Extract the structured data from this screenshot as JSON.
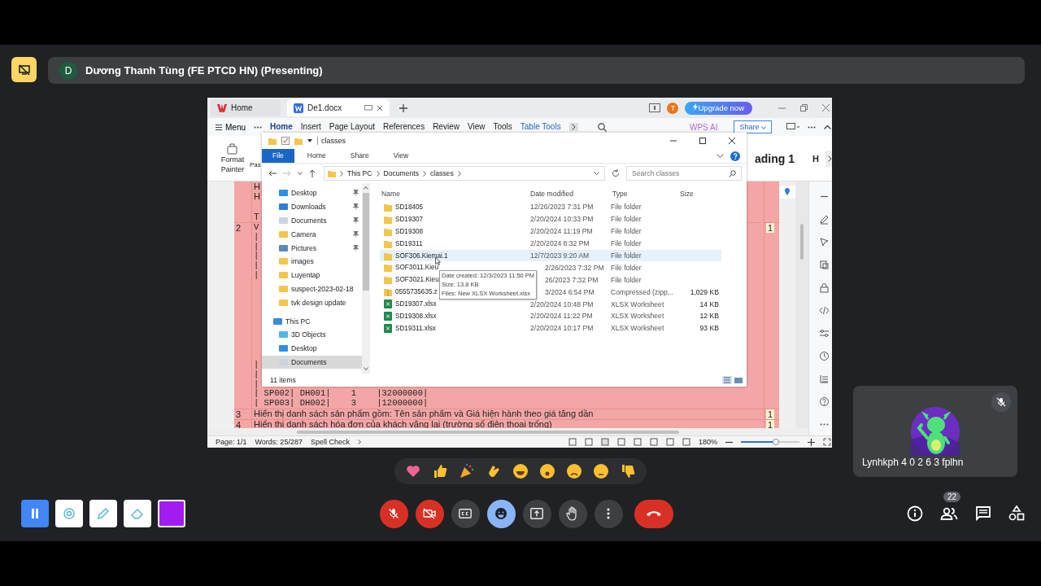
{
  "meeting": {
    "presenter_initial": "D",
    "presenter_title": "Dương Thanh Tùng (FE PTCD HN) (Presenting)"
  },
  "wps": {
    "tabs": [
      {
        "label": "Home",
        "selected": false
      },
      {
        "label": "De1.docx",
        "selected": true
      }
    ],
    "account_initial": "T",
    "upgrade_button": "Upgrade now",
    "menu_button": "Menu",
    "menu_tabs": [
      {
        "label": "Home",
        "selected": true,
        "kind": "normal"
      },
      {
        "label": "Insert",
        "selected": false,
        "kind": "normal"
      },
      {
        "label": "Page Layout",
        "selected": false,
        "kind": "normal"
      },
      {
        "label": "References",
        "selected": false,
        "kind": "normal"
      },
      {
        "label": "Review",
        "selected": false,
        "kind": "normal"
      },
      {
        "label": "View",
        "selected": false,
        "kind": "normal"
      },
      {
        "label": "Tools",
        "selected": false,
        "kind": "normal"
      },
      {
        "label": "Table Tools",
        "selected": false,
        "kind": "contextual"
      }
    ],
    "ai_button": "WPS AI",
    "share_button": "Share",
    "ribbon": {
      "format_painter": "Format Painter",
      "paste": "Pas",
      "style_heading": "ading 1",
      "style_next": "H"
    },
    "rows": [
      {
        "kind": "text",
        "blocks": [
          [
            "H",
            "H"
          ],
          [
            "T"
          ]
        ]
      },
      {
        "kind": "code",
        "number": "2",
        "count": "1",
        "blocks": [
          [
            "V",
            "|",
            "|",
            "|",
            "|",
            "|"
          ],
          [
            "|",
            "|",
            "|",
            "| SP002| DH001|    1    |32000000|",
            "| SP003| DH002|    3    |12000000|"
          ]
        ]
      },
      {
        "kind": "text",
        "number": "3",
        "count": "1",
        "blocks": [
          [
            "Hiển thị danh sách sản phẩm gồm: Tên sản phẩm và Giá hiện hành theo giá tăng dần"
          ]
        ]
      },
      {
        "kind": "text",
        "number": "4",
        "count": "1",
        "blocks": [
          [
            "Hiển thị danh sách hóa đơn của khách vãng lai (trường số điện thoại trống)"
          ]
        ]
      }
    ],
    "status_bar": {
      "page": "Page: 1/1",
      "words": "Words: 25/287",
      "spell_check": "Spell Check",
      "zoom": "180%",
      "level": 0.58
    }
  },
  "explorer": {
    "title": "classes",
    "ribbon_tabs": [
      {
        "label": "File",
        "kind": "file"
      },
      {
        "label": "Home",
        "kind": "tab"
      },
      {
        "label": "Share",
        "kind": "tab"
      },
      {
        "label": "View",
        "kind": "tab"
      }
    ],
    "path": [
      "This PC",
      "Documents",
      "classes"
    ],
    "search": {
      "placeholder": "Search classes"
    },
    "nav": [
      {
        "label": "Desktop",
        "kind": "desktop",
        "pinned": true,
        "selected": false
      },
      {
        "label": "Downloads",
        "kind": "downloads",
        "pinned": true,
        "selected": false
      },
      {
        "label": "Documents",
        "kind": "documents",
        "pinned": true,
        "selected": false
      },
      {
        "label": "Camera",
        "kind": "folder",
        "pinned": true,
        "selected": false
      },
      {
        "label": "Pictures",
        "kind": "pictures",
        "pinned": true,
        "selected": false
      },
      {
        "label": "images",
        "kind": "folder",
        "pinned": false,
        "selected": false
      },
      {
        "label": "Luyentap",
        "kind": "folder",
        "pinned": false,
        "selected": false
      },
      {
        "label": "suspect-2023-02-18",
        "kind": "folder",
        "pinned": false,
        "selected": false
      },
      {
        "label": "tvk design update",
        "kind": "folder",
        "pinned": false,
        "selected": false
      },
      {
        "label": "This PC",
        "kind": "pc",
        "pinned": false,
        "selected": false,
        "children": [
          {
            "label": "3D Objects",
            "kind": "objects",
            "selected": false
          },
          {
            "label": "Desktop",
            "kind": "desktop",
            "selected": false
          },
          {
            "label": "Documents",
            "kind": "documents",
            "selected": true
          }
        ]
      }
    ],
    "columns": [
      "Name",
      "Date modified",
      "Type",
      "Size"
    ],
    "files": [
      {
        "name": "SD18405",
        "date": "12/26/2023 7:31 PM",
        "type": "File folder",
        "kind": "folder",
        "selected": false
      },
      {
        "name": "SD19307",
        "date": "2/20/2024 10:33 PM",
        "type": "File folder",
        "kind": "folder",
        "selected": false
      },
      {
        "name": "SD19308",
        "date": "2/20/2024 11:19 PM",
        "type": "File folder",
        "kind": "folder",
        "selected": false
      },
      {
        "name": "SD19311",
        "date": "2/20/2024 8:32 PM",
        "type": "File folder",
        "kind": "folder",
        "selected": false
      },
      {
        "name": "SOF306.Kiemai.1",
        "date": "12/7/2023 9:20 AM",
        "type": "File folder",
        "kind": "folder",
        "selected": true
      },
      {
        "name": "SOF3011.Kieu",
        "date": "2/26/2023 7:32 PM",
        "type": "File folder",
        "kind": "folder",
        "selected": false
      },
      {
        "name": "SOF3021.Kieu",
        "date": "26/2023 7:32 PM",
        "type": "File folder",
        "kind": "folder",
        "selected": false
      },
      {
        "name": "0555735635.z",
        "date": "3/2024 6:54 PM",
        "type": "Compressed (zipp...",
        "size": "1,029 KB",
        "kind": "zip",
        "selected": false
      },
      {
        "name": "SD19307.xlsx",
        "date": "2/20/2024 10:48 PM",
        "type": "XLSX Worksheet",
        "size": "14 KB",
        "kind": "sheet",
        "selected": false
      },
      {
        "name": "SD19308.xlsx",
        "date": "2/20/2024 11:22 PM",
        "type": "XLSX Worksheet",
        "size": "12 KB",
        "kind": "sheet",
        "selected": false
      },
      {
        "name": "SD19311.xlsx",
        "date": "2/20/2024 10:17 PM",
        "type": "XLSX Worksheet",
        "size": "93 KB",
        "kind": "sheet",
        "selected": false
      }
    ],
    "tooltip": [
      "Date created: 12/3/2023 11:50 PM",
      "Size: 13.8 KB",
      "Files: New XLSX Worksheet.xlsx"
    ],
    "item_count": "11 items"
  },
  "participant": {
    "name": "Lynhkph 4 0 2 6 3 fplhn",
    "muted": true
  },
  "controls": {
    "mic_on": false,
    "camera_on": false,
    "reactions_open": true,
    "participants_count": "22"
  }
}
